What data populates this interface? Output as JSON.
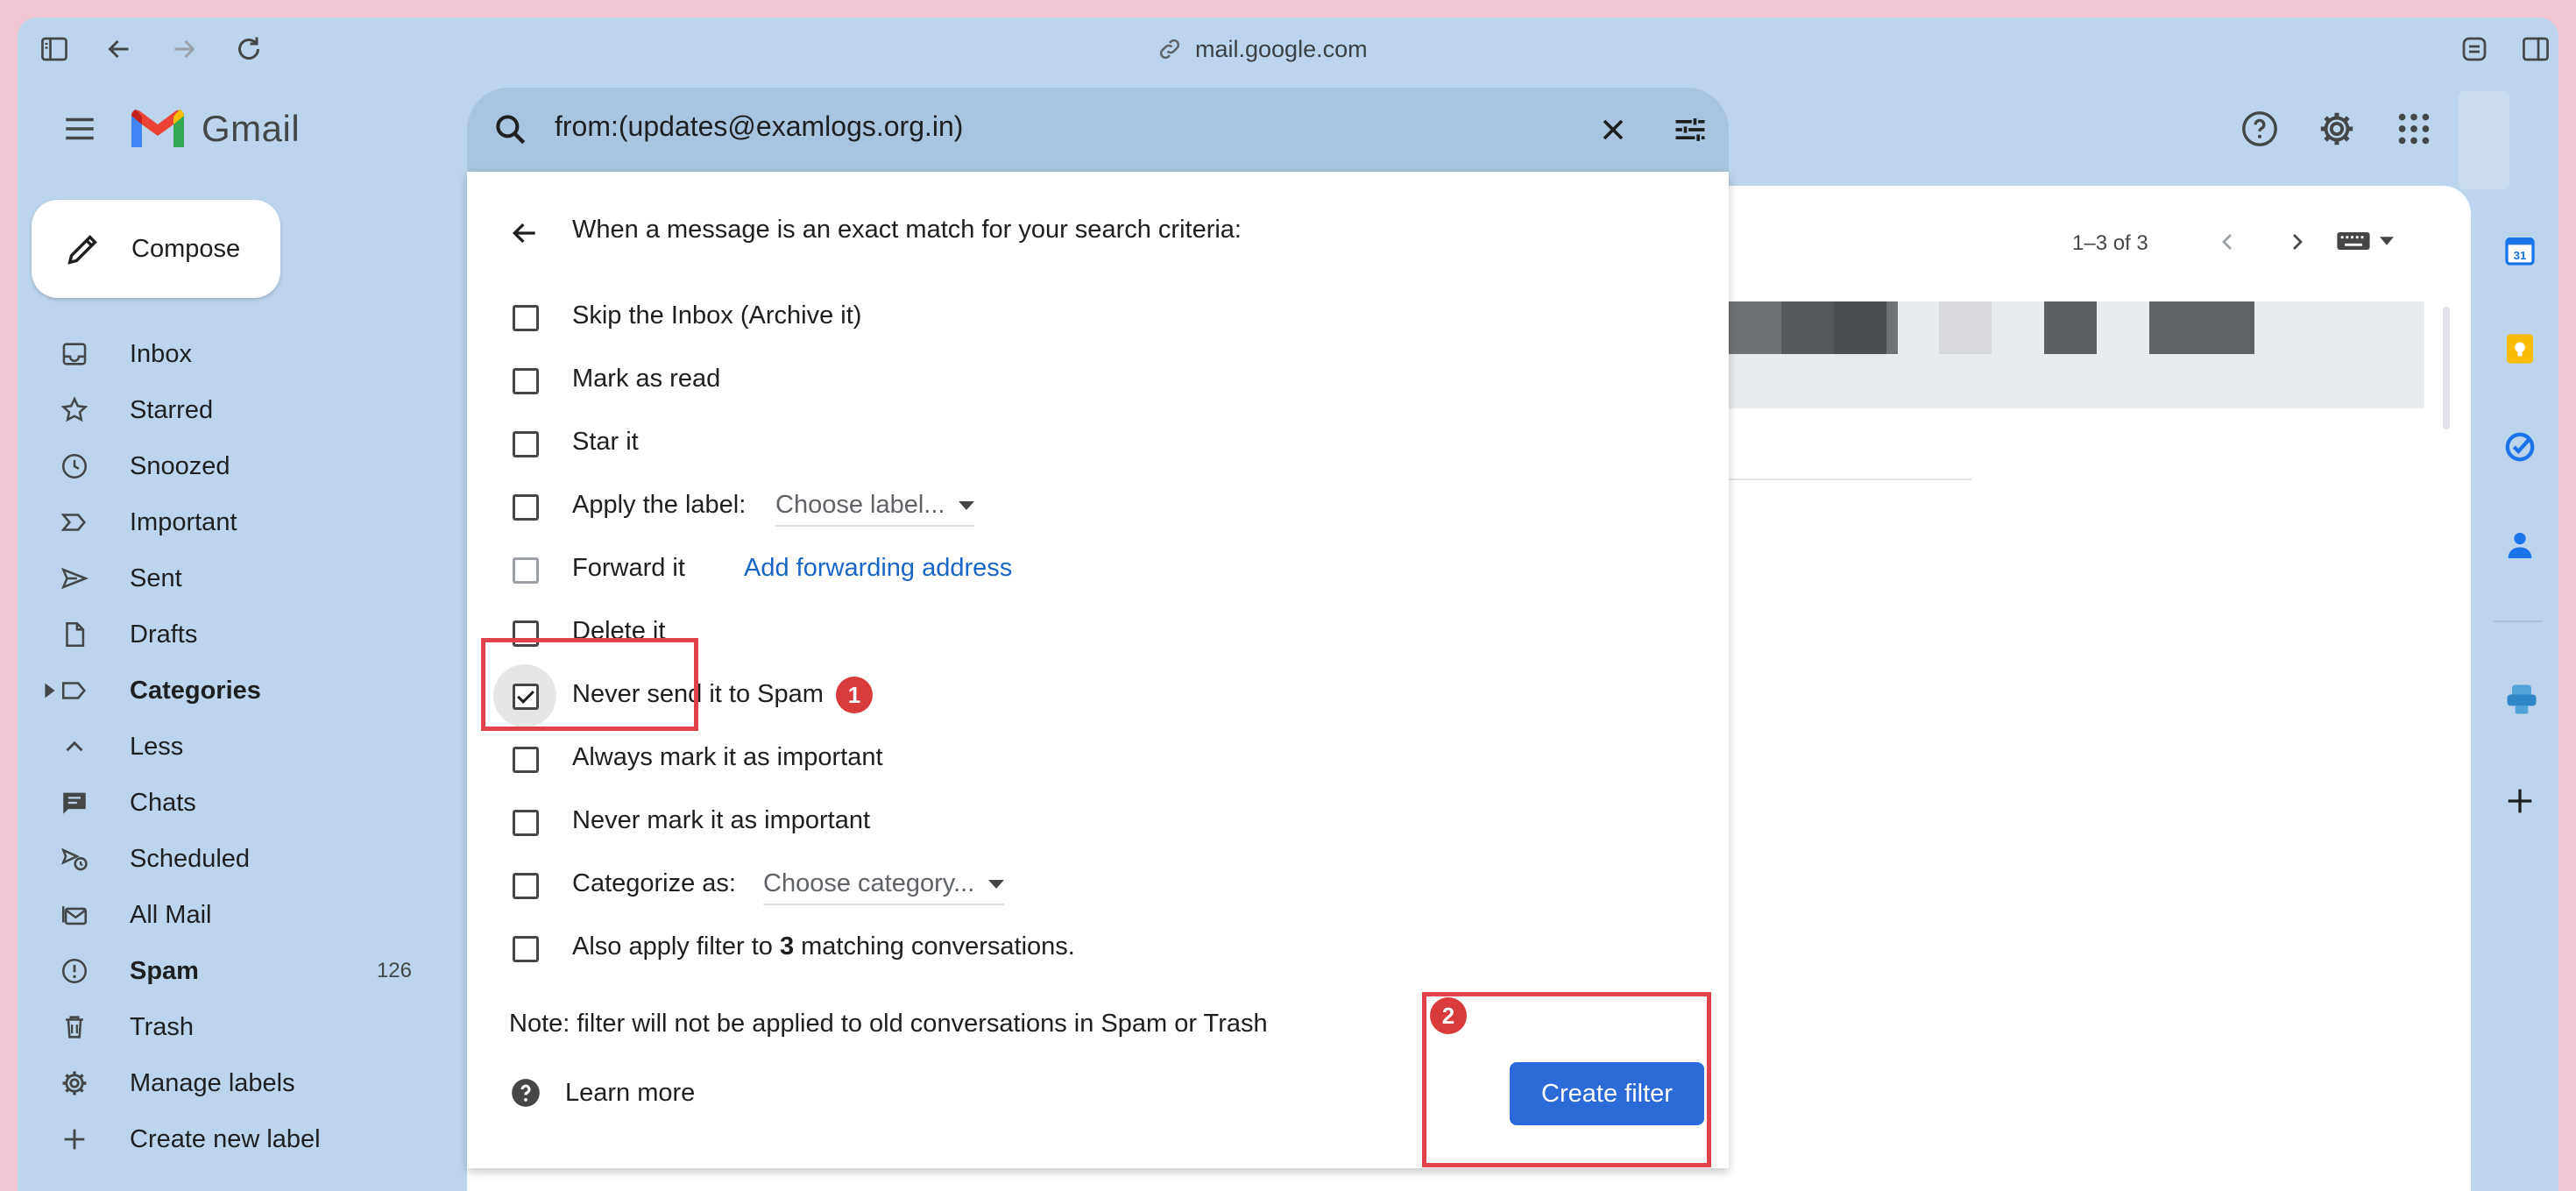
{
  "browser": {
    "url": "mail.google.com"
  },
  "gmail": {
    "logo_text": "Gmail",
    "search_query": "from:(updates@examlogs.org.in)"
  },
  "compose": {
    "label": "Compose"
  },
  "sidebar": {
    "items": [
      {
        "label": "Inbox",
        "icon": "inbox-icon"
      },
      {
        "label": "Starred",
        "icon": "star-icon"
      },
      {
        "label": "Snoozed",
        "icon": "clock-icon"
      },
      {
        "label": "Important",
        "icon": "important-icon"
      },
      {
        "label": "Sent",
        "icon": "send-icon"
      },
      {
        "label": "Drafts",
        "icon": "draft-icon"
      },
      {
        "label": "Categories",
        "icon": "label-icon",
        "bold": true
      },
      {
        "label": "Less",
        "icon": "chevron-up-icon"
      },
      {
        "label": "Chats",
        "icon": "chat-icon"
      },
      {
        "label": "Scheduled",
        "icon": "scheduled-icon"
      },
      {
        "label": "All Mail",
        "icon": "all-mail-icon"
      },
      {
        "label": "Spam",
        "icon": "spam-icon",
        "bold": true,
        "count": "126"
      },
      {
        "label": "Trash",
        "icon": "trash-icon"
      },
      {
        "label": "Manage labels",
        "icon": "gear-icon"
      },
      {
        "label": "Create new label",
        "icon": "plus-icon"
      }
    ]
  },
  "main": {
    "pager_text": "1–3 of 3"
  },
  "filter_dialog": {
    "title": "When a message is an exact match for your search criteria:",
    "options": [
      {
        "label": "Skip the Inbox (Archive it)",
        "checked": false
      },
      {
        "label": "Mark as read",
        "checked": false
      },
      {
        "label": "Star it",
        "checked": false
      },
      {
        "label": "Apply the label:",
        "checked": false,
        "select": "Choose label..."
      },
      {
        "label": "Forward it",
        "checked": false,
        "link": "Add forwarding address"
      },
      {
        "label": "Delete it",
        "checked": false
      },
      {
        "label": "Never send it to Spam",
        "checked": true
      },
      {
        "label": "Always mark it as important",
        "checked": false
      },
      {
        "label": "Never mark it as important",
        "checked": false
      },
      {
        "label": "Categorize as:",
        "checked": false,
        "select": "Choose category..."
      },
      {
        "label_prefix": "Also apply filter to ",
        "label_count": "3",
        "label_suffix": " matching conversations.",
        "checked": false
      }
    ],
    "note": "Note: filter will not be applied to old conversations in Spam or Trash",
    "learn_more": "Learn more",
    "create_button": "Create filter"
  },
  "annotations": {
    "step1": "1",
    "step2": "2"
  },
  "colors": {
    "accent": "#2a6ad9",
    "annotation": "#e0414a",
    "window_bg": "#bcd5ec"
  }
}
